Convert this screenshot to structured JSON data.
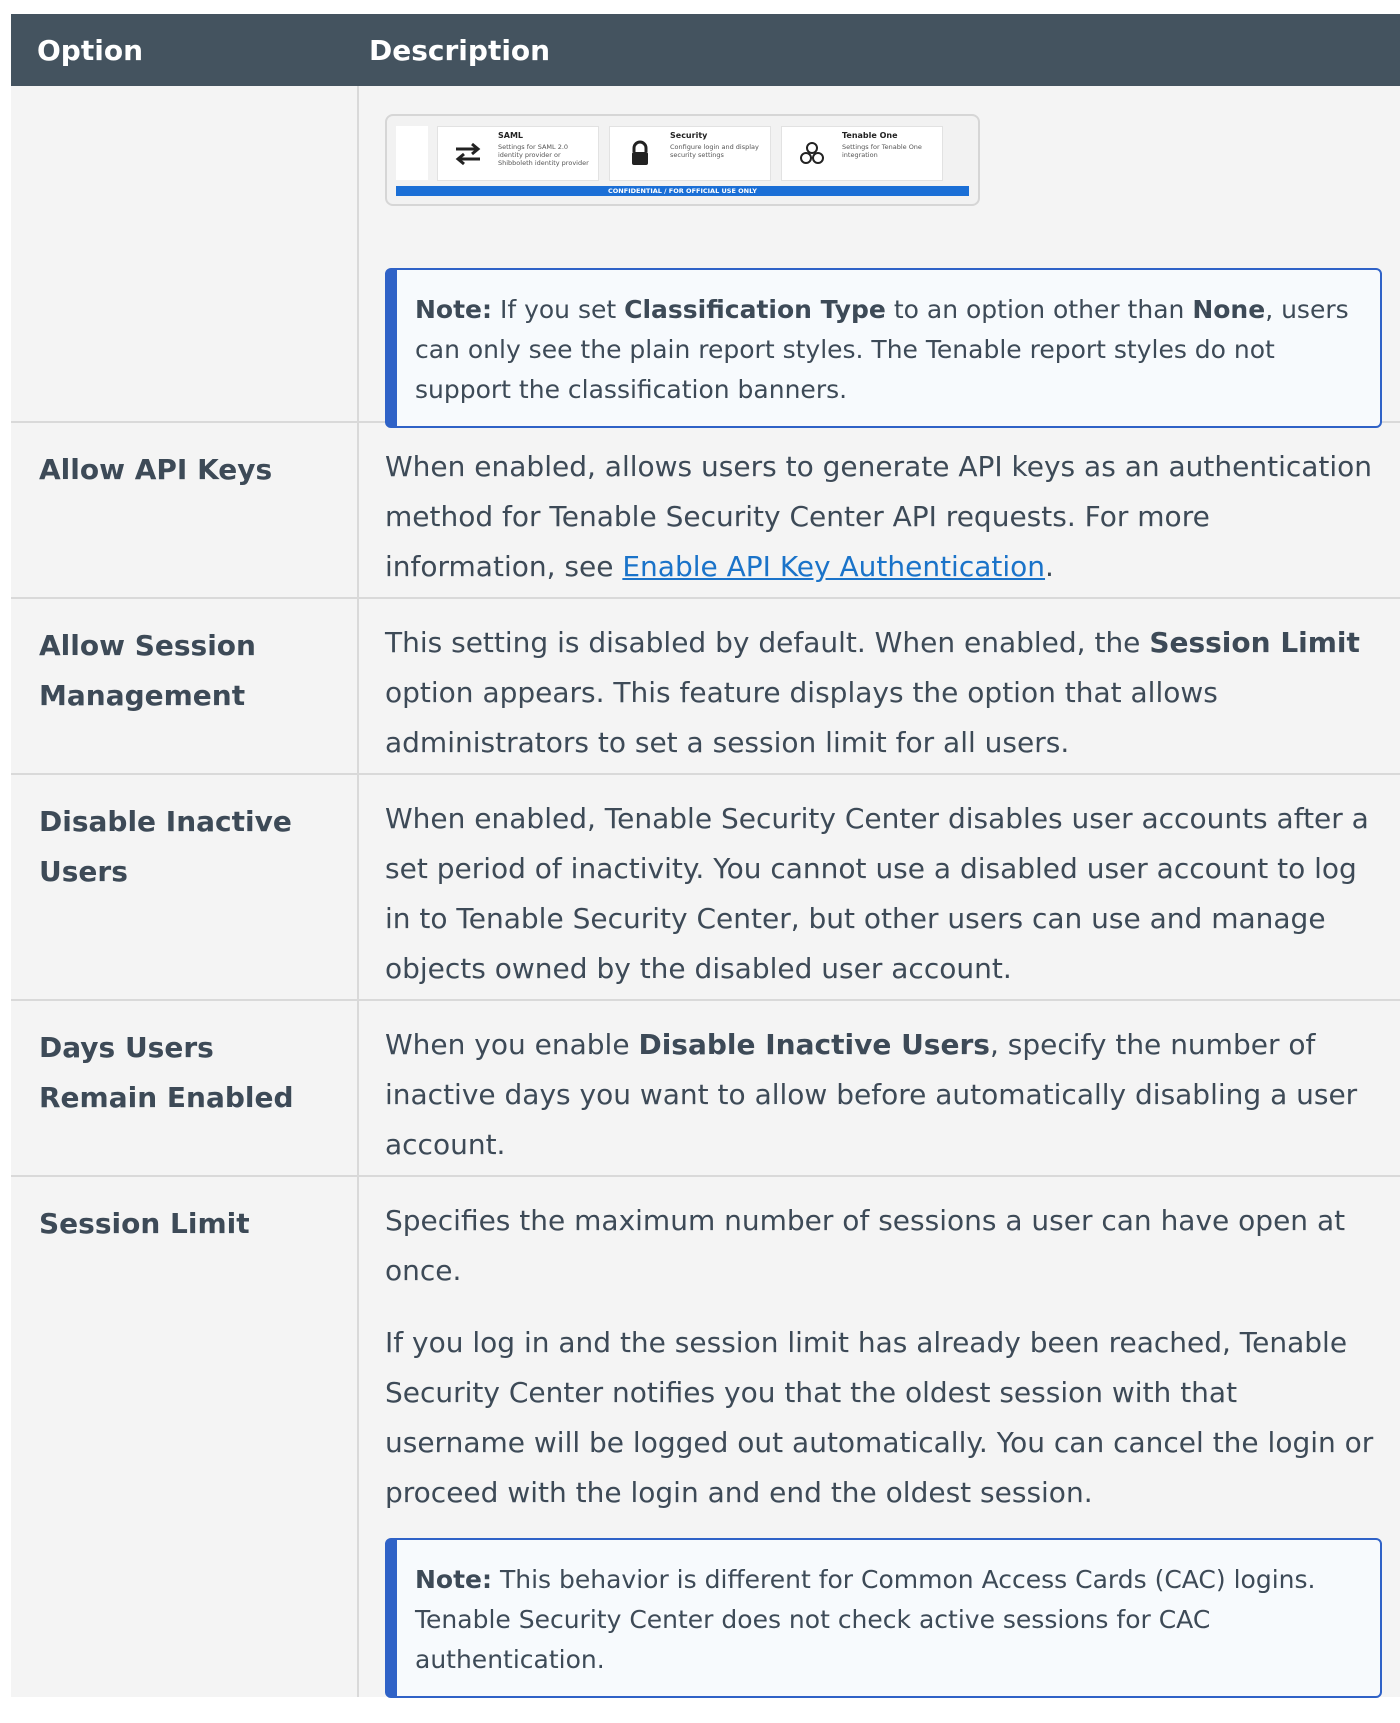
{
  "header": {
    "option": "Option",
    "description": "Description"
  },
  "classification_row": {
    "thumbnail": {
      "cards": [
        {
          "title": "SAML",
          "desc": "Settings for SAML 2.0 identity provider or Shibboleth identity provider",
          "icon": "swap-arrows-icon"
        },
        {
          "title": "Security",
          "desc": "Configure login and display security settings",
          "icon": "lock-icon"
        },
        {
          "title": "Tenable One",
          "desc": "Settings for Tenable One integration",
          "icon": "hexagon-cluster-icon"
        }
      ],
      "banner": "CONFIDENTIAL / FOR OFFICIAL USE ONLY",
      "banner_color": "#1b6fd6"
    },
    "note": {
      "label": "Note:",
      "t1": " If you set ",
      "b1": "Classification Type",
      "t2": " to an option other than ",
      "b2": "None",
      "t3": ", users can only see the plain report styles. The Tenable report styles do not support the classification banners."
    }
  },
  "rows": {
    "api_keys": {
      "option": "Allow API Keys",
      "t1": "When enabled, allows users to generate API keys as an authentication method for Tenable Security Center API requests. For more information, see ",
      "link": "Enable API Key Authentication",
      "t2": "."
    },
    "session_mgmt": {
      "option": "Allow Session Management",
      "t1": "This setting is disabled by default. When enabled, the ",
      "b1": "Session Limit",
      "t2": " option appears. This feature displays the option that allows administrators to set a session limit for all users."
    },
    "disable_inactive": {
      "option": "Disable Inactive Users",
      "text": "When enabled, Tenable Security Center disables user accounts after a set period of inactivity. You cannot use a disabled user account to log in to Tenable Security Center, but other users can use and manage objects owned by the disabled user account."
    },
    "days_enabled": {
      "option": "Days Users Remain Enabled",
      "t1": "When you enable ",
      "b1": "Disable Inactive Users",
      "t2": ", specify the number of inactive days you want to allow before automatically disabling a user account."
    },
    "session_limit": {
      "option": "Session Limit",
      "p1": "Specifies the maximum number of sessions a user can have open at once.",
      "p2": "If you log in and the session limit has already been reached, Tenable Security Center notifies you that the oldest session with that username will be logged out automatically. You can cancel the login or proceed with the login and end the oldest session.",
      "note_label": "Note:",
      "note_text": " This behavior is different for Common Access Cards (CAC) logins. Tenable Security Center does not check active sessions for CAC authentication."
    }
  },
  "colors": {
    "header_bg": "#44535f",
    "row_bg": "#f4f4f4",
    "note_accent": "#2f62c7",
    "link": "#1a73c9"
  }
}
